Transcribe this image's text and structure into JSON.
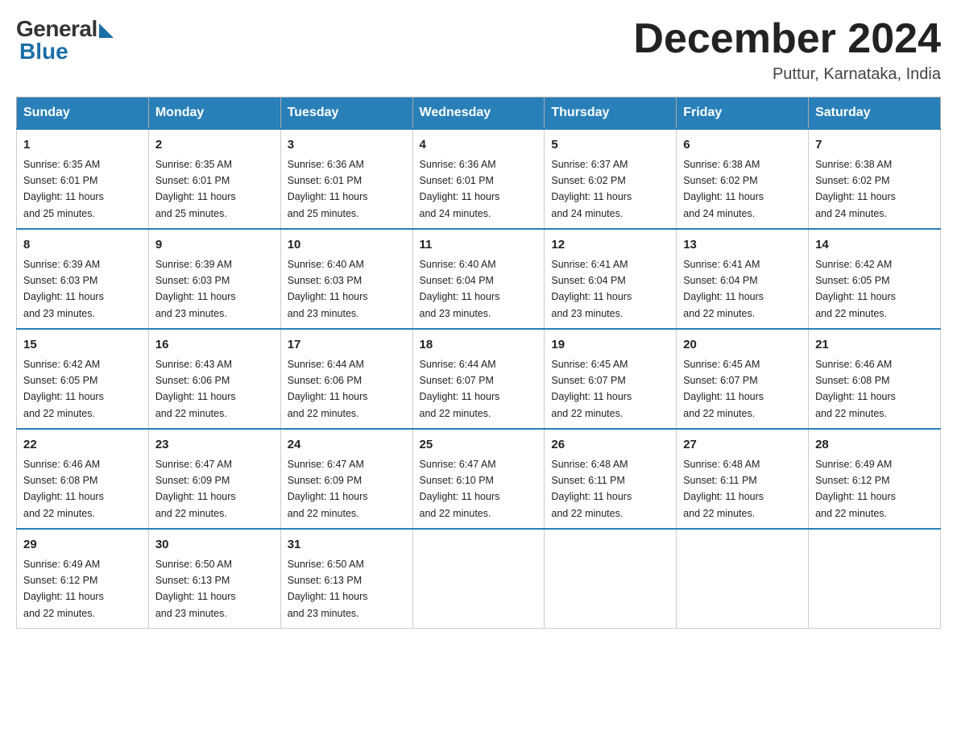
{
  "logo": {
    "general": "General",
    "blue": "Blue"
  },
  "title": {
    "month_year": "December 2024",
    "location": "Puttur, Karnataka, India"
  },
  "days_of_week": [
    "Sunday",
    "Monday",
    "Tuesday",
    "Wednesday",
    "Thursday",
    "Friday",
    "Saturday"
  ],
  "weeks": [
    [
      {
        "day": "1",
        "sunrise": "6:35 AM",
        "sunset": "6:01 PM",
        "daylight": "11 hours and 25 minutes."
      },
      {
        "day": "2",
        "sunrise": "6:35 AM",
        "sunset": "6:01 PM",
        "daylight": "11 hours and 25 minutes."
      },
      {
        "day": "3",
        "sunrise": "6:36 AM",
        "sunset": "6:01 PM",
        "daylight": "11 hours and 25 minutes."
      },
      {
        "day": "4",
        "sunrise": "6:36 AM",
        "sunset": "6:01 PM",
        "daylight": "11 hours and 24 minutes."
      },
      {
        "day": "5",
        "sunrise": "6:37 AM",
        "sunset": "6:02 PM",
        "daylight": "11 hours and 24 minutes."
      },
      {
        "day": "6",
        "sunrise": "6:38 AM",
        "sunset": "6:02 PM",
        "daylight": "11 hours and 24 minutes."
      },
      {
        "day": "7",
        "sunrise": "6:38 AM",
        "sunset": "6:02 PM",
        "daylight": "11 hours and 24 minutes."
      }
    ],
    [
      {
        "day": "8",
        "sunrise": "6:39 AM",
        "sunset": "6:03 PM",
        "daylight": "11 hours and 23 minutes."
      },
      {
        "day": "9",
        "sunrise": "6:39 AM",
        "sunset": "6:03 PM",
        "daylight": "11 hours and 23 minutes."
      },
      {
        "day": "10",
        "sunrise": "6:40 AM",
        "sunset": "6:03 PM",
        "daylight": "11 hours and 23 minutes."
      },
      {
        "day": "11",
        "sunrise": "6:40 AM",
        "sunset": "6:04 PM",
        "daylight": "11 hours and 23 minutes."
      },
      {
        "day": "12",
        "sunrise": "6:41 AM",
        "sunset": "6:04 PM",
        "daylight": "11 hours and 23 minutes."
      },
      {
        "day": "13",
        "sunrise": "6:41 AM",
        "sunset": "6:04 PM",
        "daylight": "11 hours and 22 minutes."
      },
      {
        "day": "14",
        "sunrise": "6:42 AM",
        "sunset": "6:05 PM",
        "daylight": "11 hours and 22 minutes."
      }
    ],
    [
      {
        "day": "15",
        "sunrise": "6:42 AM",
        "sunset": "6:05 PM",
        "daylight": "11 hours and 22 minutes."
      },
      {
        "day": "16",
        "sunrise": "6:43 AM",
        "sunset": "6:06 PM",
        "daylight": "11 hours and 22 minutes."
      },
      {
        "day": "17",
        "sunrise": "6:44 AM",
        "sunset": "6:06 PM",
        "daylight": "11 hours and 22 minutes."
      },
      {
        "day": "18",
        "sunrise": "6:44 AM",
        "sunset": "6:07 PM",
        "daylight": "11 hours and 22 minutes."
      },
      {
        "day": "19",
        "sunrise": "6:45 AM",
        "sunset": "6:07 PM",
        "daylight": "11 hours and 22 minutes."
      },
      {
        "day": "20",
        "sunrise": "6:45 AM",
        "sunset": "6:07 PM",
        "daylight": "11 hours and 22 minutes."
      },
      {
        "day": "21",
        "sunrise": "6:46 AM",
        "sunset": "6:08 PM",
        "daylight": "11 hours and 22 minutes."
      }
    ],
    [
      {
        "day": "22",
        "sunrise": "6:46 AM",
        "sunset": "6:08 PM",
        "daylight": "11 hours and 22 minutes."
      },
      {
        "day": "23",
        "sunrise": "6:47 AM",
        "sunset": "6:09 PM",
        "daylight": "11 hours and 22 minutes."
      },
      {
        "day": "24",
        "sunrise": "6:47 AM",
        "sunset": "6:09 PM",
        "daylight": "11 hours and 22 minutes."
      },
      {
        "day": "25",
        "sunrise": "6:47 AM",
        "sunset": "6:10 PM",
        "daylight": "11 hours and 22 minutes."
      },
      {
        "day": "26",
        "sunrise": "6:48 AM",
        "sunset": "6:11 PM",
        "daylight": "11 hours and 22 minutes."
      },
      {
        "day": "27",
        "sunrise": "6:48 AM",
        "sunset": "6:11 PM",
        "daylight": "11 hours and 22 minutes."
      },
      {
        "day": "28",
        "sunrise": "6:49 AM",
        "sunset": "6:12 PM",
        "daylight": "11 hours and 22 minutes."
      }
    ],
    [
      {
        "day": "29",
        "sunrise": "6:49 AM",
        "sunset": "6:12 PM",
        "daylight": "11 hours and 22 minutes."
      },
      {
        "day": "30",
        "sunrise": "6:50 AM",
        "sunset": "6:13 PM",
        "daylight": "11 hours and 23 minutes."
      },
      {
        "day": "31",
        "sunrise": "6:50 AM",
        "sunset": "6:13 PM",
        "daylight": "11 hours and 23 minutes."
      },
      null,
      null,
      null,
      null
    ]
  ],
  "labels": {
    "sunrise": "Sunrise:",
    "sunset": "Sunset:",
    "daylight": "Daylight:"
  }
}
